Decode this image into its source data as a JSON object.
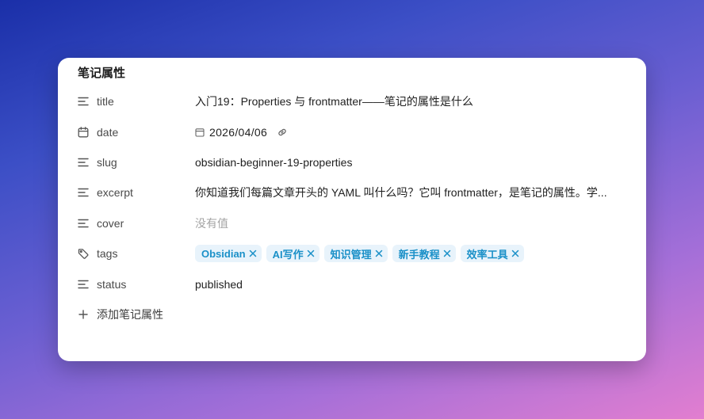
{
  "panel": {
    "title": "笔记属性"
  },
  "properties": [
    {
      "key": "title",
      "icon": "text-lines-icon",
      "value": "入门19：Properties 与 frontmatter——笔记的属性是什么"
    },
    {
      "key": "date",
      "icon": "calendar-icon",
      "value": "2026/04/06",
      "value_icon": "calendar-icon",
      "action_icon": "link-icon"
    },
    {
      "key": "slug",
      "icon": "text-lines-icon",
      "value": "obsidian-beginner-19-properties"
    },
    {
      "key": "excerpt",
      "icon": "text-lines-icon",
      "value": "你知道我们每篇文章开头的 YAML 叫什么吗？它叫 frontmatter，是笔记的属性。学..."
    },
    {
      "key": "cover",
      "icon": "text-lines-icon",
      "placeholder": "没有值"
    },
    {
      "key": "tags",
      "icon": "tag-icon",
      "tags": [
        "Obsidian",
        "AI写作",
        "知识管理",
        "新手教程",
        "效率工具"
      ]
    },
    {
      "key": "status",
      "icon": "text-lines-icon",
      "value": "published"
    }
  ],
  "add_property": {
    "label": "添加笔记属性",
    "icon": "plus-icon"
  },
  "colors": {
    "tag_bg": "#e8f3fb",
    "tag_text": "#1a90c8",
    "placeholder": "#a3a3a3"
  }
}
